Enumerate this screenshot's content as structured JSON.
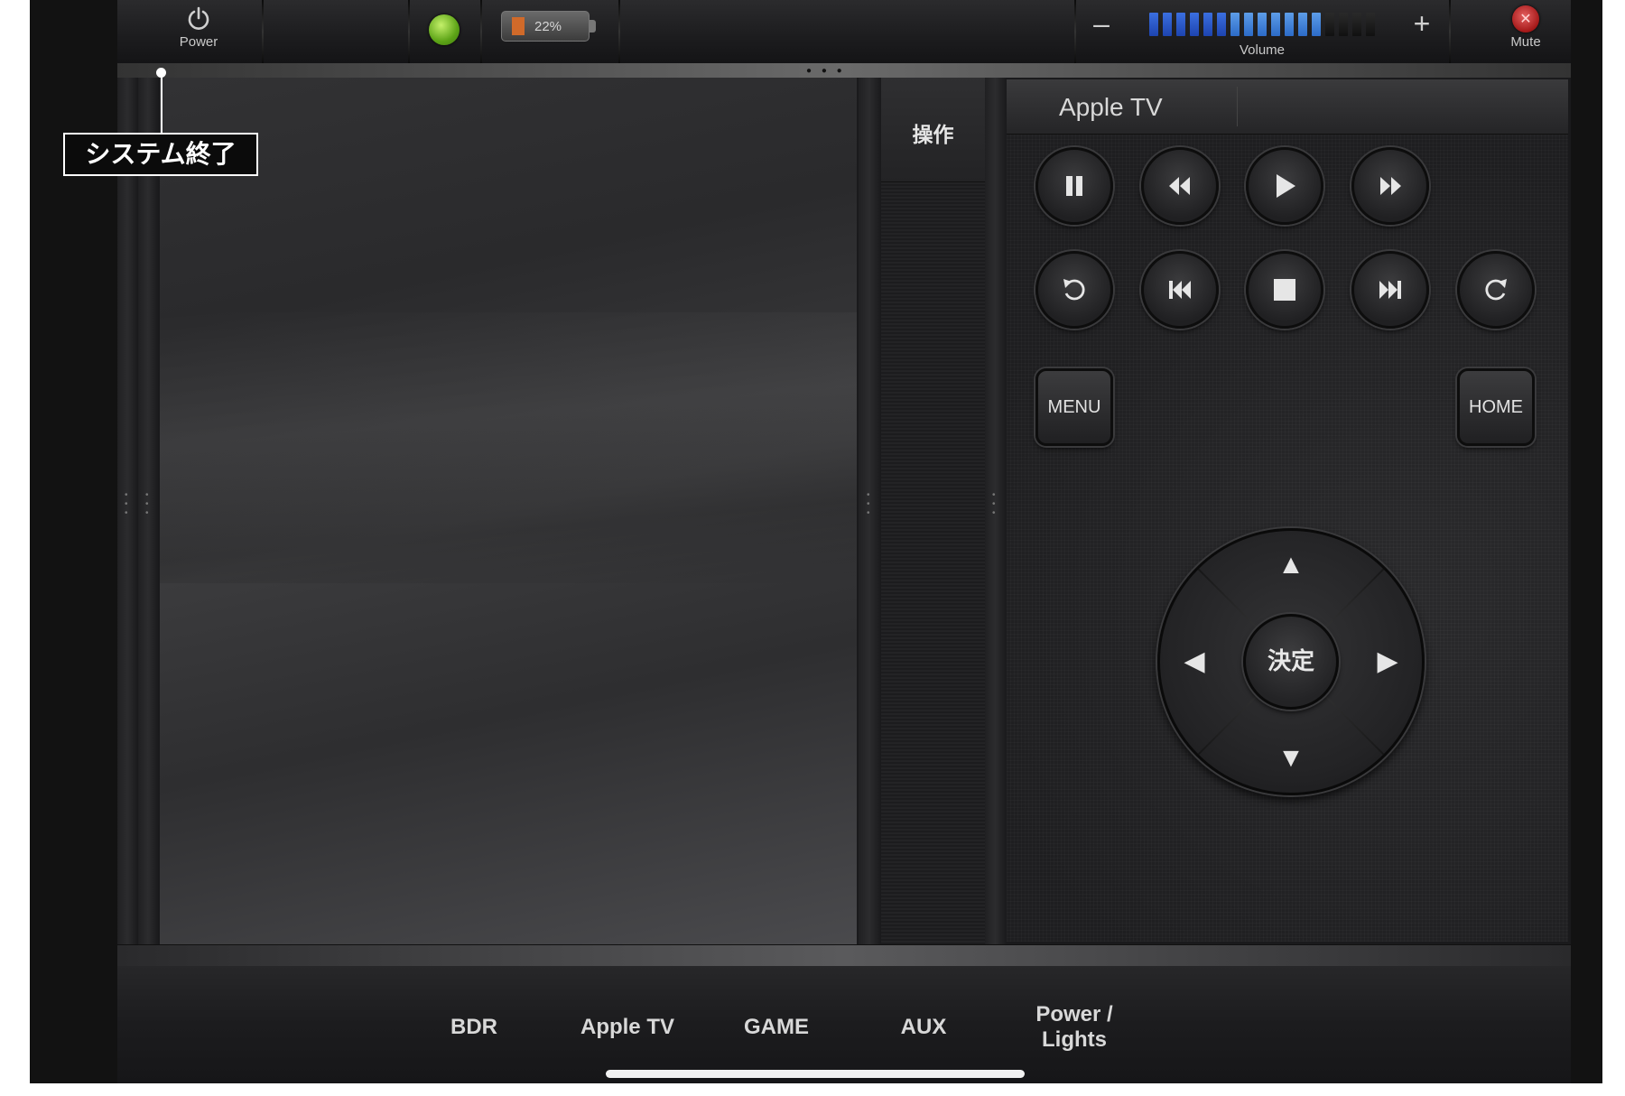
{
  "topbar": {
    "power_label": "Power",
    "battery_percent": "22%",
    "battery_level": 0.22,
    "volume_label": "Volume",
    "volume_minus": "–",
    "volume_plus": "+",
    "volume_level_segments": 13,
    "volume_total_segments": 17,
    "mute_label": "Mute",
    "status_color": "#6ab821"
  },
  "operation_tab": "操作",
  "remote": {
    "title": "Apple TV",
    "menu_label": "MENU",
    "home_label": "HOME",
    "ok_label": "決定"
  },
  "bottom_nav": {
    "items": [
      {
        "label": "BDR"
      },
      {
        "label": "Apple TV"
      },
      {
        "label": "GAME"
      },
      {
        "label": "AUX"
      },
      {
        "label": "Power /\nLights"
      }
    ]
  },
  "callout": {
    "text": "システム終了"
  },
  "icons": {
    "power": "power-icon",
    "mute": "mute-icon",
    "pause": "pause-icon",
    "rewind": "rewind-icon",
    "play": "play-icon",
    "fast_forward": "fast-forward-icon",
    "replay": "replay-icon",
    "skip_back": "skip-back-icon",
    "stop": "stop-icon",
    "skip_forward": "skip-forward-icon",
    "redo": "redo-icon"
  },
  "colors": {
    "accent_volume": "#2f66d6",
    "battery_fill": "#d06a2a",
    "mute_red": "#c42a2a"
  }
}
